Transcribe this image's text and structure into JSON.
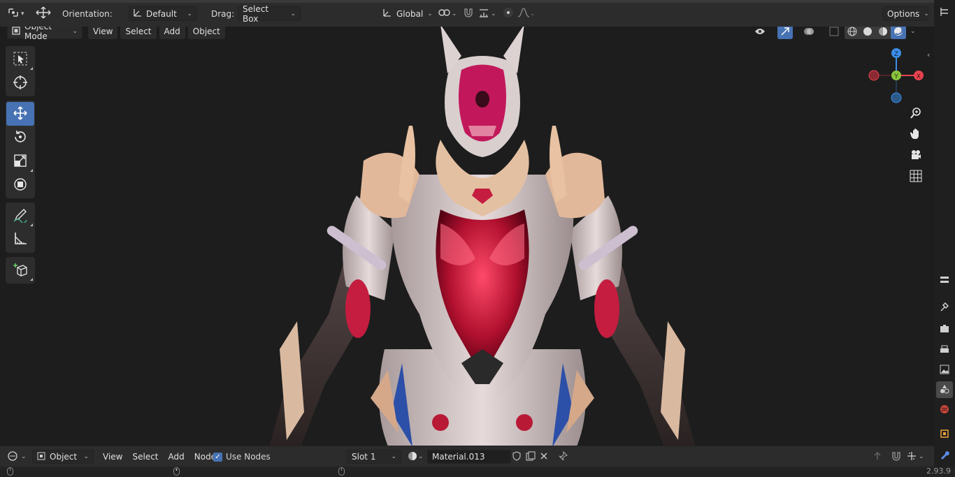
{
  "header": {
    "orientation_label": "Orientation:",
    "orientation_value": "Default",
    "drag_label": "Drag:",
    "drag_value": "Select Box",
    "transform_space": "Global",
    "options_label": "Options"
  },
  "viewport": {
    "mode": "Object Mode",
    "menus": [
      "View",
      "Select",
      "Add",
      "Object"
    ]
  },
  "tools": [
    {
      "name": "select-box-tool",
      "icon": "cursor-box-icon",
      "active": false
    },
    {
      "name": "cursor-tool",
      "icon": "crosshair-icon",
      "active": false
    },
    {
      "name": "move-tool",
      "icon": "move-arrows-icon",
      "active": true
    },
    {
      "name": "rotate-tool",
      "icon": "rotate-icon",
      "active": false
    },
    {
      "name": "scale-tool",
      "icon": "scale-icon",
      "active": false
    },
    {
      "name": "transform-tool",
      "icon": "transform-icon",
      "active": false
    },
    {
      "name": "annotate-tool",
      "icon": "pencil-icon",
      "active": false
    },
    {
      "name": "measure-tool",
      "icon": "ruler-icon",
      "active": false
    },
    {
      "name": "add-cube-tool",
      "icon": "add-cube-icon",
      "active": false
    }
  ],
  "gizmo": {
    "z": "Z",
    "y": "Y",
    "x": "X"
  },
  "bottom": {
    "editor_type": "Object",
    "menus": [
      "View",
      "Select",
      "Add",
      "Node"
    ],
    "use_nodes_label": "Use Nodes",
    "use_nodes_checked": true,
    "slot": "Slot 1",
    "material": "Material.013"
  },
  "status": {
    "version": "2.93.9"
  },
  "colors": {
    "accent": "#4772b3",
    "axis_x": "#e8434f",
    "axis_y": "#8bc33c",
    "axis_z": "#3c8ee8",
    "model_red": "#c41d3f",
    "model_white": "#d9cfcf"
  }
}
